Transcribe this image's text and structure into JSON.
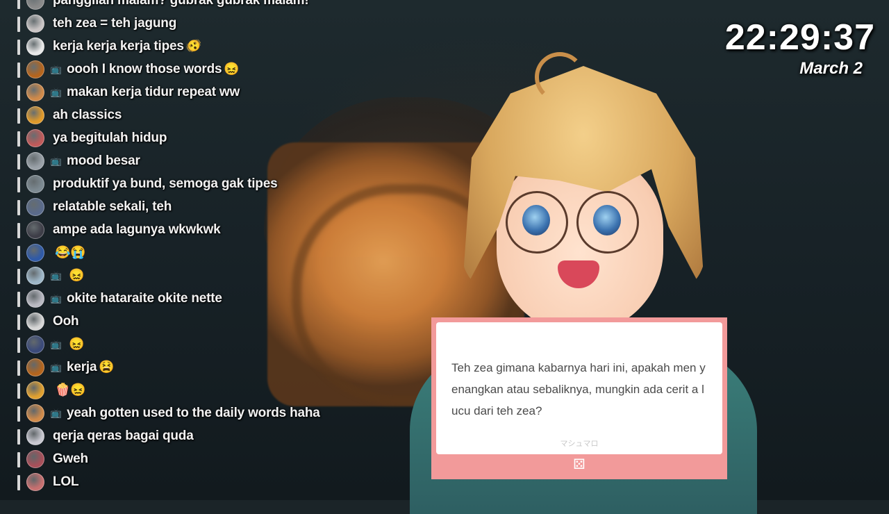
{
  "clock": {
    "time": "22:29:37",
    "date": "March 2"
  },
  "chat": {
    "messages": [
      {
        "text": "panggilan malam? gubrak gubrak malam!",
        "member": false,
        "emote": "",
        "color": "#8a8a8a"
      },
      {
        "text": "teh zea = teh jagung",
        "member": false,
        "emote": "",
        "color": "#c9c4c4"
      },
      {
        "text": "kerja kerja kerja tipes",
        "member": false,
        "emote": "🫨",
        "color": "#e8e8e8"
      },
      {
        "text": "oooh I know those words",
        "member": true,
        "emote": "😖",
        "color": "#b5651d"
      },
      {
        "text": "makan kerja tidur repeat ww",
        "member": true,
        "emote": "",
        "color": "#d08a4a"
      },
      {
        "text": "ah classics",
        "member": false,
        "emote": "",
        "color": "#e09a2b"
      },
      {
        "text": "ya begitulah hidup",
        "member": false,
        "emote": "",
        "color": "#c05a5a"
      },
      {
        "text": "mood besar",
        "member": true,
        "emote": "",
        "color": "#9aa1a8"
      },
      {
        "text": "produktif ya bund, semoga gak tipes",
        "member": false,
        "emote": "",
        "color": "#7d8a92"
      },
      {
        "text": "relatable sekali, teh",
        "member": false,
        "emote": "",
        "color": "#5a6b8c"
      },
      {
        "text": "ampe ada lagunya wkwkwk",
        "member": false,
        "emote": "",
        "color": "#3e3e48"
      },
      {
        "text": "",
        "member": false,
        "emote": "😂😭",
        "color": "#2f5aa8"
      },
      {
        "text": "",
        "member": true,
        "emote": "😖",
        "color": "#9fb8c9"
      },
      {
        "text": "okite hataraite okite nette",
        "member": true,
        "emote": "",
        "color": "#b9b9c2"
      },
      {
        "text": "Ooh",
        "member": false,
        "emote": "",
        "color": "#d6d6d6"
      },
      {
        "text": "",
        "member": true,
        "emote": "😖",
        "color": "#3b4a7a"
      },
      {
        "text": "kerja",
        "member": true,
        "emote": "😫",
        "color": "#b5651d"
      },
      {
        "text": "",
        "member": false,
        "emote": "🍿😖",
        "color": "#e0a030"
      },
      {
        "text": "yeah gotten used to the daily words haha",
        "member": true,
        "emote": "",
        "color": "#d08a4a"
      },
      {
        "text": "qerja qeras bagai quda",
        "member": false,
        "emote": "",
        "color": "#c8c8d0"
      },
      {
        "text": "Gweh",
        "member": false,
        "emote": "",
        "color": "#a8505a"
      },
      {
        "text": "LOL",
        "member": false,
        "emote": "",
        "color": "#c77070"
      }
    ]
  },
  "card": {
    "text": "Teh zea gimana kabarnya hari ini, apakah men yenangkan atau sebaliknya, mungkin ada cerit a lucu dari teh zea?",
    "brand": "マシュマロ"
  },
  "colors": {
    "card_border": "#f29a9a",
    "clock_text": "#ffffff"
  }
}
